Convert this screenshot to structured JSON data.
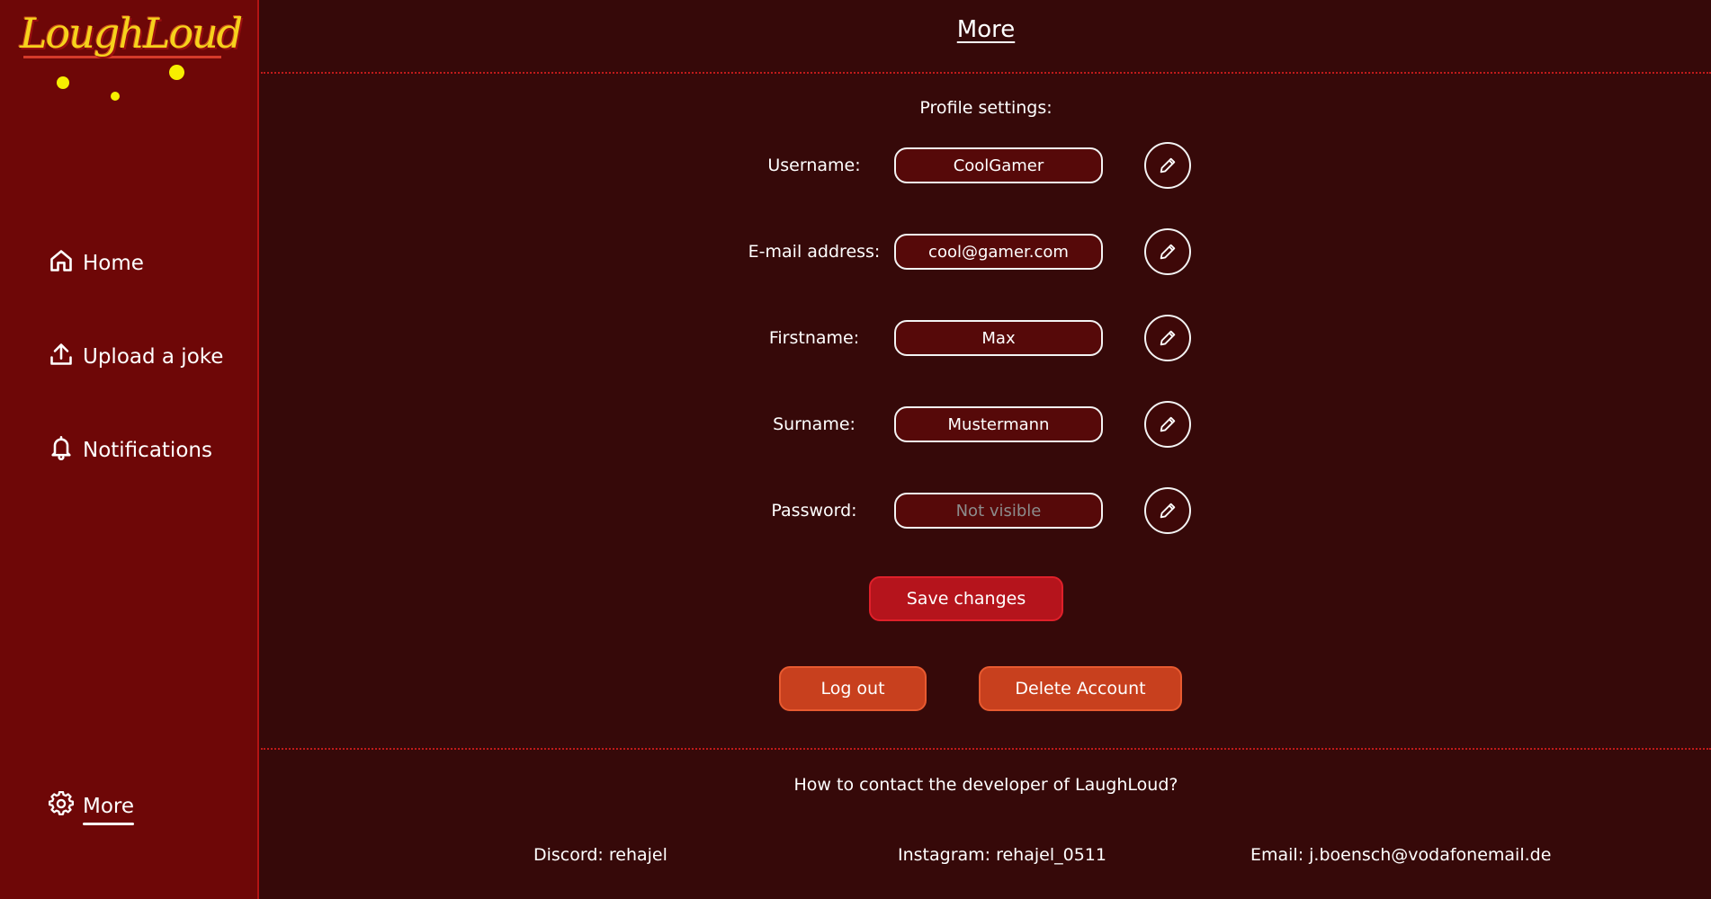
{
  "app": {
    "name": "LaughLoud",
    "logo_text": "LoughLoud"
  },
  "sidebar": {
    "items": [
      {
        "label": "Home",
        "icon": "home-icon"
      },
      {
        "label": "Upload a joke",
        "icon": "upload-icon"
      },
      {
        "label": "Notifications",
        "icon": "bell-icon"
      },
      {
        "label": "More",
        "icon": "gear-icon",
        "active": true
      }
    ]
  },
  "header": {
    "title": "More"
  },
  "profile": {
    "section_title": "Profile settings:",
    "fields": [
      {
        "label": "Username:",
        "value": "CoolGamer",
        "placeholder": ""
      },
      {
        "label": "E-mail address:",
        "value": "cool@gamer.com",
        "placeholder": ""
      },
      {
        "label": "Firstname:",
        "value": "Max",
        "placeholder": ""
      },
      {
        "label": "Surname:",
        "value": "Mustermann",
        "placeholder": ""
      },
      {
        "label": "Password:",
        "value": "",
        "placeholder": "Not visible"
      }
    ],
    "save_label": "Save changes",
    "logout_label": "Log out",
    "delete_label": "Delete Account"
  },
  "contact": {
    "title": "How to contact the developer of LaughLoud?",
    "discord": "Discord: rehajel",
    "instagram": "Instagram: rehajel_0511",
    "email": "Email: j.boensch@vodafonemail.de"
  },
  "colors": {
    "sidebar_bg": "#6e0707",
    "main_bg": "#360909",
    "logo_yellow": "#f6d21c",
    "save_red": "#b5141c",
    "action_orange": "#c8401e"
  }
}
